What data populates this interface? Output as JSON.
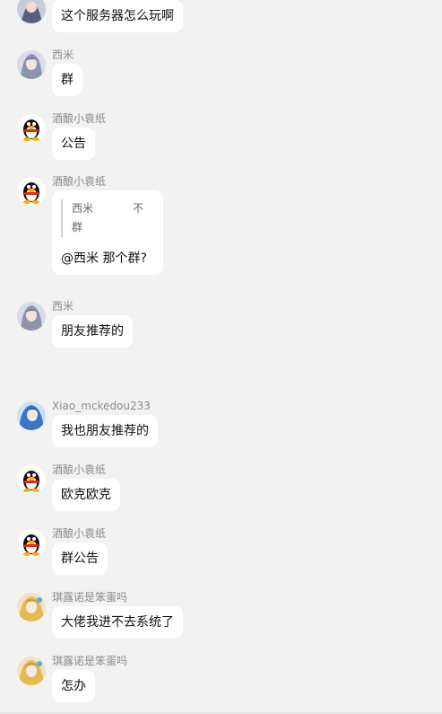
{
  "messages": [
    {
      "sender": "",
      "text": "这个服务器怎么玩啊",
      "avatar": "anime-dark"
    },
    {
      "sender": "西米",
      "text": "群",
      "avatar": "anime-girl"
    },
    {
      "sender": "酒酿小袁纸",
      "text": "公告",
      "avatar": "qq-penguin"
    },
    {
      "sender": "酒酿小袁纸",
      "quote": {
        "name": "西米",
        "tail": "不",
        "text": "群"
      },
      "text": "@西米  那个群?",
      "avatar": "qq-penguin"
    },
    {
      "sender": "西米",
      "text": "朋友推荐的",
      "avatar": "anime-girl"
    },
    {
      "sender": "Xiao_mckedou233",
      "text": "我也朋友推荐的",
      "avatar": "anime-blue"
    },
    {
      "sender": "酒酿小袁纸",
      "text": "欧克欧克",
      "avatar": "qq-penguin"
    },
    {
      "sender": "酒酿小袁纸",
      "text": "群公告",
      "avatar": "qq-penguin"
    },
    {
      "sender": "琪露诺是笨蛋吗",
      "text": "大佬我进不去系统了",
      "avatar": "anime-blonde"
    },
    {
      "sender": "琪露诺是笨蛋吗",
      "text": "怎办",
      "avatar": "anime-blonde"
    }
  ],
  "colors": {
    "background": "#f2f2f2",
    "bubble": "#ffffff",
    "name": "#8a8a8a"
  }
}
